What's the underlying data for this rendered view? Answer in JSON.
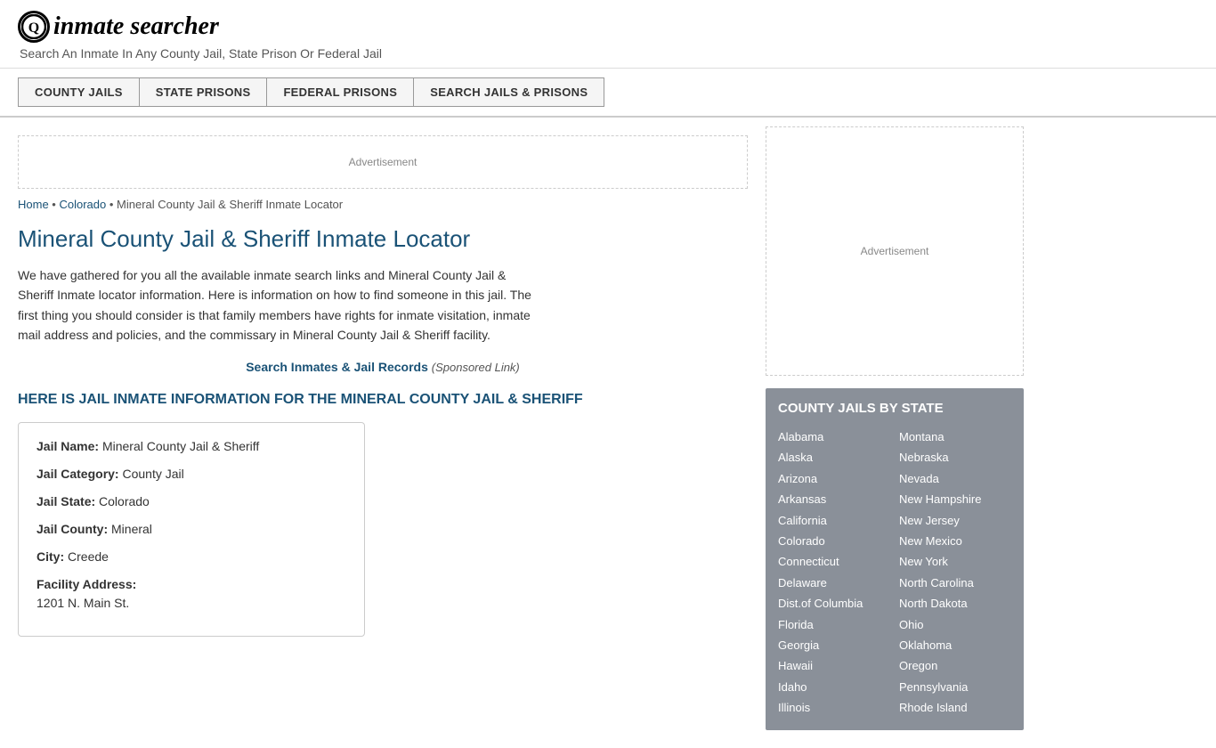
{
  "header": {
    "logo_icon": "Q",
    "logo_text": "inmate searcher",
    "tagline": "Search An Inmate In Any County Jail, State Prison Or Federal Jail"
  },
  "navbar": {
    "buttons": [
      {
        "id": "county-jails",
        "label": "COUNTY JAILS"
      },
      {
        "id": "state-prisons",
        "label": "STATE PRISONS"
      },
      {
        "id": "federal-prisons",
        "label": "FEDERAL PRISONS"
      },
      {
        "id": "search-jails",
        "label": "SEARCH JAILS & PRISONS"
      }
    ]
  },
  "breadcrumb": {
    "home": "Home",
    "separator1": " • ",
    "state": "Colorado",
    "separator2": " • ",
    "current": "Mineral County Jail & Sheriff Inmate Locator"
  },
  "page": {
    "title": "Mineral County Jail & Sheriff Inmate Locator",
    "description": "We have gathered for you all the available inmate search links and Mineral County Jail & Sheriff Inmate locator information. Here is information on how to find someone in this jail. The first thing you should consider is that family members have rights for inmate visitation, inmate mail address and policies, and the commissary in Mineral County Jail & Sheriff facility.",
    "search_link_text": "Search Inmates & Jail Records",
    "search_link_sponsored": "(Sponsored Link)",
    "info_heading": "HERE IS JAIL INMATE INFORMATION FOR THE MINERAL COUNTY JAIL & SHERIFF",
    "ad_label": "Advertisement"
  },
  "jail_info": {
    "name_label": "Jail Name:",
    "name_value": "Mineral County Jail & Sheriff",
    "category_label": "Jail Category:",
    "category_value": "County Jail",
    "state_label": "Jail State:",
    "state_value": "Colorado",
    "county_label": "Jail County:",
    "county_value": "Mineral",
    "city_label": "City:",
    "city_value": "Creede",
    "address_label": "Facility Address:",
    "address_value": "1201 N. Main St."
  },
  "sidebar": {
    "ad_label": "Advertisement",
    "state_box_title": "COUNTY JAILS BY STATE",
    "states_col1": [
      "Alabama",
      "Alaska",
      "Arizona",
      "Arkansas",
      "California",
      "Colorado",
      "Connecticut",
      "Delaware",
      "Dist.of Columbia",
      "Florida",
      "Georgia",
      "Hawaii",
      "Idaho",
      "Illinois"
    ],
    "states_col2": [
      "Montana",
      "Nebraska",
      "Nevada",
      "New Hampshire",
      "New Jersey",
      "New Mexico",
      "New York",
      "North Carolina",
      "North Dakota",
      "Ohio",
      "Oklahoma",
      "Oregon",
      "Pennsylvania",
      "Rhode Island"
    ]
  }
}
